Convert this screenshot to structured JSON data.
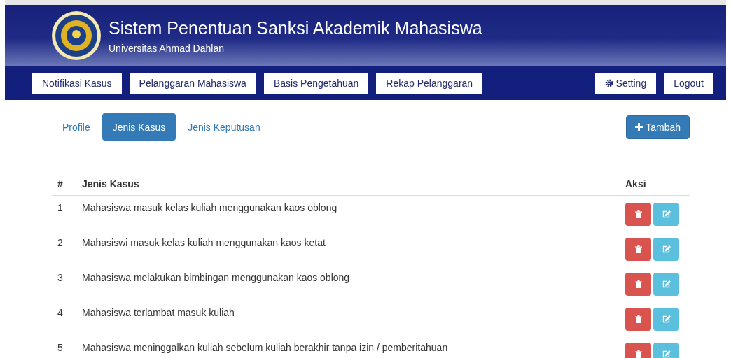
{
  "header": {
    "title": "Sistem Penentuan Sanksi Akademik Mahasiswa",
    "subtitle": "Universitas Ahmad Dahlan"
  },
  "nav": {
    "left": [
      {
        "label": "Notifikasi Kasus"
      },
      {
        "label": "Pelanggaran Mahasiswa"
      },
      {
        "label": "Basis Pengetahuan"
      },
      {
        "label": "Rekap Pelanggaran"
      }
    ],
    "right": [
      {
        "label": "Setting",
        "kind": "gear"
      },
      {
        "label": "Logout",
        "kind": "plain"
      }
    ]
  },
  "tabs": [
    {
      "label": "Profile",
      "selected": false
    },
    {
      "label": "Jenis Kasus",
      "selected": true
    },
    {
      "label": "Jenis Keputusan",
      "selected": false
    }
  ],
  "add_button": {
    "label": "Tambah"
  },
  "table": {
    "columns": [
      "#",
      "Jenis Kasus",
      "Aksi"
    ],
    "rows": [
      {
        "no": "1",
        "case": "Mahasiswa masuk kelas kuliah menggunakan kaos oblong"
      },
      {
        "no": "2",
        "case": "Mahasiswi masuk kelas kuliah menggunakan kaos ketat"
      },
      {
        "no": "3",
        "case": "Mahasiswa melakukan bimbingan menggunakan kaos oblong"
      },
      {
        "no": "4",
        "case": "Mahasiswa terlambat masuk kuliah"
      },
      {
        "no": "5",
        "case": "Mahasiswa meninggalkan kuliah sebelum kuliah berakhir tanpa izin / pemberitahuan"
      }
    ]
  }
}
